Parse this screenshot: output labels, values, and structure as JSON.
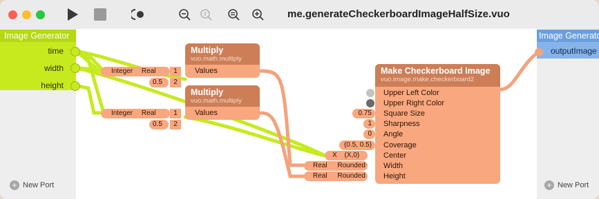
{
  "window": {
    "title": "me.generateCheckerboardImageHalfSize.vuo",
    "traffic_lights": {
      "close": "#fe5f57",
      "minimize": "#febc2e",
      "zoom": "#28c840"
    },
    "toolbar_icons": [
      "play-icon",
      "stop-icon",
      "show-events-icon",
      "zoom-out-icon",
      "zoom-actual-icon",
      "zoom-to-fit-icon",
      "zoom-in-icon"
    ]
  },
  "published_inputs": {
    "title": "Image Generator",
    "ports": [
      "time",
      "width",
      "height"
    ],
    "new_port": "New Port"
  },
  "published_outputs": {
    "title": "Image Generator",
    "ports": [
      "outputImage"
    ],
    "new_port": "New Port"
  },
  "nodes": {
    "multiply1": {
      "title": "Multiply",
      "class": "vuo.math.multiply",
      "port": "Values"
    },
    "multiply2": {
      "title": "Multiply",
      "class": "vuo.math.multiply",
      "port": "Values"
    },
    "checker": {
      "title": "Make Checkerboard Image",
      "class": "vuo.image.make.checkerboard2",
      "ports": [
        "Upper Left Color",
        "Upper Right Color",
        "Square Size",
        "Sharpness",
        "Angle",
        "Coverage",
        "Center",
        "Width",
        "Height"
      ],
      "constants": {
        "square_size": "0.75",
        "sharpness": "1",
        "angle": "0",
        "coverage": "(0.5, 0.5)"
      }
    }
  },
  "converters": {
    "int_real_1": {
      "from": "Integer",
      "to": "Real"
    },
    "int_real_2": {
      "from": "Integer",
      "to": "Real"
    },
    "real_rounded_1": {
      "from": "Real",
      "to": "Rounded"
    },
    "real_rounded_2": {
      "from": "Real",
      "to": "Rounded"
    },
    "make_point": {
      "x": "X",
      "out": "(X,0)"
    }
  },
  "list_items": {
    "m1_item1": "1",
    "m1_item2": "2",
    "m1_const": "0.5",
    "m2_item1": "1",
    "m2_item2": "2",
    "m2_const": "0.5"
  },
  "colors": {
    "node_body": "#f9a77e",
    "node_header": "#cd7e57",
    "wire_event": "#c6ea1f",
    "wire_data": "#f4a27c",
    "published_in": "#c7ea1e",
    "published_out": "#86b4ea",
    "upper_left_color": "#c4c4c4",
    "upper_right_color": "#6b6b6b"
  }
}
